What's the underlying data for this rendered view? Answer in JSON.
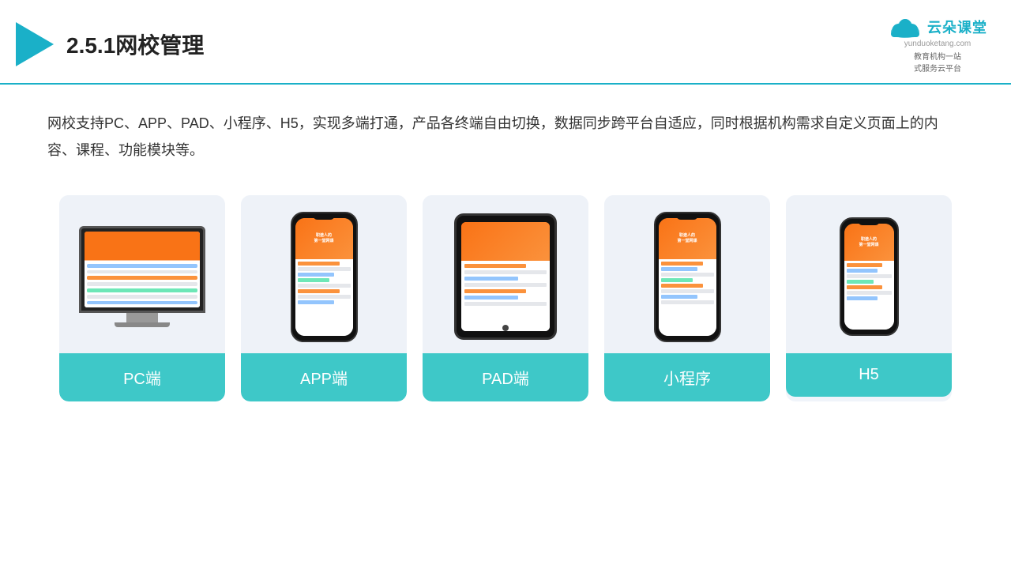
{
  "header": {
    "title": "2.5.1网校管理",
    "logo_main": "云朵课堂",
    "logo_url": "yunduoketang.com",
    "logo_sub1": "教育机构一站",
    "logo_sub2": "式服务云平台"
  },
  "description": {
    "text": "网校支持PC、APP、PAD、小程序、H5，实现多端打通，产品各终端自由切换，数据同步跨平台自适应，同时根据机构需求自定义页面上的内容、课程、功能模块等。"
  },
  "cards": [
    {
      "id": "pc",
      "label": "PC端"
    },
    {
      "id": "app",
      "label": "APP端"
    },
    {
      "id": "pad",
      "label": "PAD端"
    },
    {
      "id": "miniprogram",
      "label": "小程序"
    },
    {
      "id": "h5",
      "label": "H5"
    }
  ],
  "colors": {
    "teal": "#3ec8c8",
    "accent": "#1ab0c8",
    "border_bottom": "#1ab0c8"
  }
}
